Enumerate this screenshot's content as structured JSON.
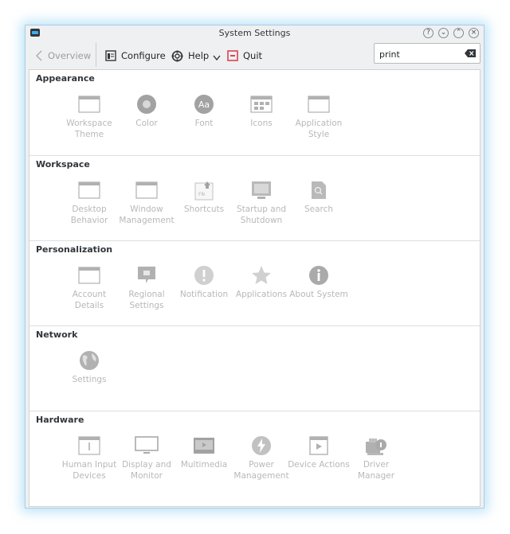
{
  "window": {
    "title": "System Settings"
  },
  "toolbar": {
    "overview_label": "Overview",
    "configure_label": "Configure",
    "help_label": "Help",
    "quit_label": "Quit"
  },
  "search": {
    "value": "print",
    "placeholder": ""
  },
  "sections": [
    {
      "title": "Appearance",
      "items": [
        {
          "label": "Workspace Theme",
          "icon": "window-icon"
        },
        {
          "label": "Color",
          "icon": "color-icon"
        },
        {
          "label": "Font",
          "icon": "font-icon"
        },
        {
          "label": "Icons",
          "icon": "icons-icon"
        },
        {
          "label": "Application Style",
          "icon": "window-icon"
        }
      ]
    },
    {
      "title": "Workspace",
      "items": [
        {
          "label": "Desktop Behavior",
          "icon": "window-icon"
        },
        {
          "label": "Window Management",
          "icon": "window-icon"
        },
        {
          "label": "Shortcuts",
          "icon": "shortcuts-icon"
        },
        {
          "label": "Startup and Shutdown",
          "icon": "startup-icon"
        },
        {
          "label": "Search",
          "icon": "search-icon"
        }
      ]
    },
    {
      "title": "Personalization",
      "items": [
        {
          "label": "Account Details",
          "icon": "window-icon"
        },
        {
          "label": "Regional Settings",
          "icon": "regional-icon"
        },
        {
          "label": "Notification",
          "icon": "notification-icon"
        },
        {
          "label": "Applications",
          "icon": "star-icon"
        },
        {
          "label": "About System",
          "icon": "info-icon"
        }
      ]
    },
    {
      "title": "Network",
      "items": [
        {
          "label": "Settings",
          "icon": "globe-icon"
        }
      ]
    },
    {
      "title": "Hardware",
      "items": [
        {
          "label": "Human Input Devices",
          "icon": "input-icon"
        },
        {
          "label": "Display and Monitor",
          "icon": "monitor-icon"
        },
        {
          "label": "Multimedia",
          "icon": "multimedia-icon"
        },
        {
          "label": "Power Management",
          "icon": "power-icon"
        },
        {
          "label": "Device Actions",
          "icon": "device-actions-icon"
        },
        {
          "label": "Driver Manager",
          "icon": "driver-icon"
        }
      ]
    }
  ]
}
